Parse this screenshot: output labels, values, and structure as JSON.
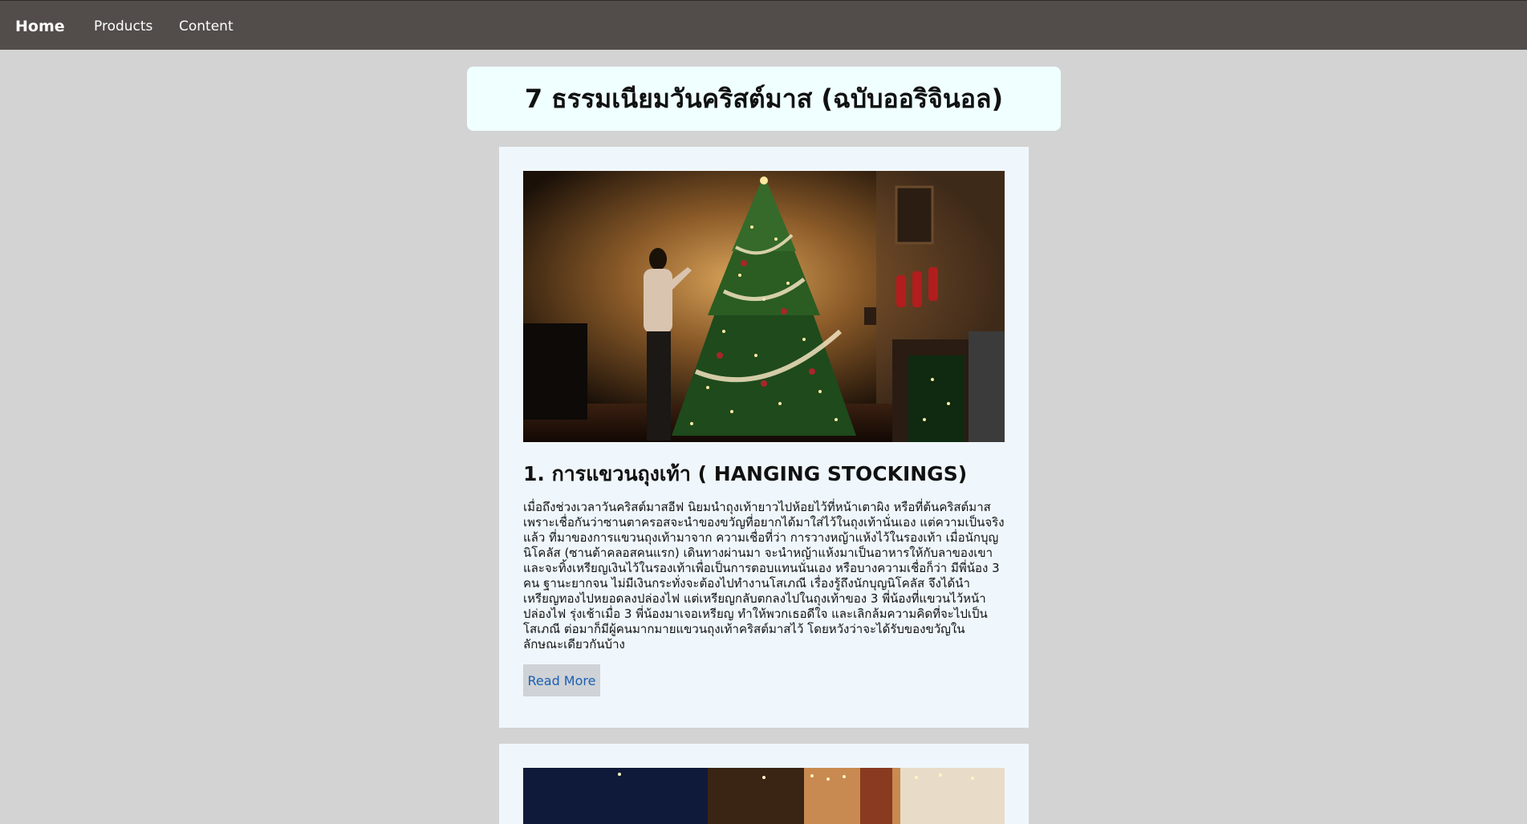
{
  "nav": {
    "home_label": "Home",
    "products_label": "Products",
    "content_label": "Content"
  },
  "page": {
    "title": "7 ธรรมเนียมวันคริสต์มาส (ฉบับออริจินอล)"
  },
  "articles": [
    {
      "heading": "1. การแขวนถุงเท้า ( HANGING STOCKINGS)",
      "body": "เมื่อถึงช่วงเวลาวันคริสต์มาสอีฟ นิยมนำถุงเท้ายาวไปห้อยไว้ที่หน้าเตาผิง หรือที่ต้นคริสต์มาส เพราะเชื่อกันว่าซานตาครอสจะนำของขวัญที่อยากได้มาใส่ไว้ในถุงเท้านั่นเอง แต่ความเป็นจริงแล้ว ที่มาของการแขวนถุงเท้ามาจาก ความเชื่อที่ว่า การวางหญ้าแห้งไว้ในรองเท้า เมื่อนักบุญนิโคลัส (ซานต้าคลอสคนแรก) เดินทางผ่านมา จะนำหญ้าแห้งมาเป็นอาหารให้กับลาของเขา และจะทิ้งเหรียญเงินไว้ในรองเท้าเพื่อเป็นการตอบแทนนั่นเอง หรือบางความเชื่อก็ว่า มีพี่น้อง 3 คน ฐานะยากจน ไม่มีเงินกระทั่งจะต้องไปทำงานโสเภณี เรื่องรู้ถึงนักบุญนิโคลัส จึงได้นำเหรียญทองไปหยอดลงปล่องไฟ แต่เหรียญกลับตกลงไปในถุงเท้าของ 3 พี่น้องที่แขวนไว้หน้าปล่องไฟ รุ่งเช้าเมื่อ 3 พี่น้องมาเจอเหรียญ ทำให้พวกเธอดีใจ และเลิกล้มความคิดที่จะไปเป็นโสเภณี ต่อมาก็มีผู้คนมากมายแขวนถุงเท้าคริสต์มาสไว้ โดยหวังว่าจะได้รับของขวัญในลักษณะเดียวกันบ้าง",
      "read_more_label": "Read More"
    }
  ]
}
